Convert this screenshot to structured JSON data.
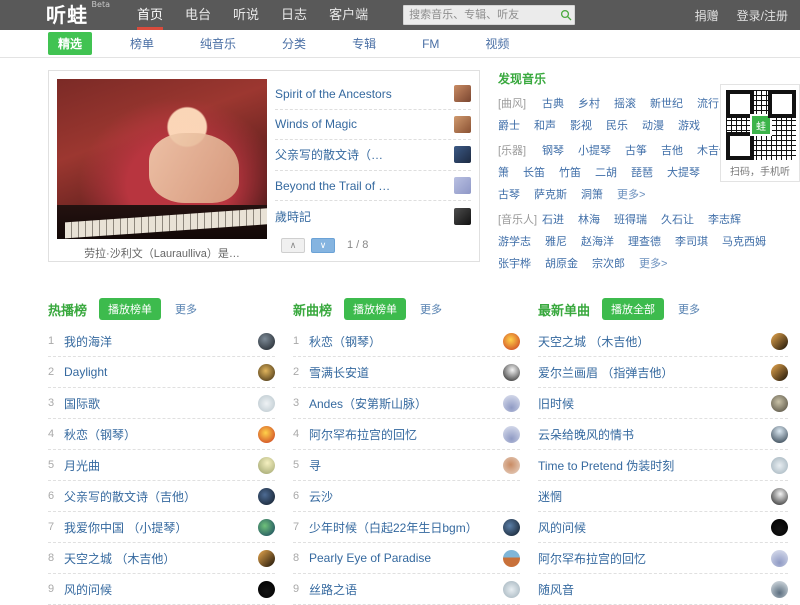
{
  "header": {
    "logo": "听蛙",
    "logo_badge": "Beta",
    "nav": [
      {
        "label": "首页",
        "active": true
      },
      {
        "label": "电台",
        "active": false
      },
      {
        "label": "听说",
        "active": false
      },
      {
        "label": "日志",
        "active": false
      },
      {
        "label": "客户端",
        "active": false
      }
    ],
    "search": {
      "placeholder": "搜索音乐、专辑、听友",
      "value": "",
      "icon": "search-icon"
    },
    "links": [
      {
        "label": "捐赠"
      },
      {
        "label": "登录/注册"
      }
    ],
    "accent_red": "#d94b3c",
    "bar_bg": "#595959"
  },
  "subnav": {
    "items": [
      {
        "label": "精选",
        "active": true
      },
      {
        "label": "榜单",
        "active": false
      },
      {
        "label": "纯音乐",
        "active": false
      },
      {
        "label": "分类",
        "active": false
      },
      {
        "label": "专辑",
        "active": false
      },
      {
        "label": "FM",
        "active": false
      },
      {
        "label": "视频",
        "active": false
      }
    ],
    "active_color": "#41c352"
  },
  "feature": {
    "caption": "劳拉·沙利文（Lauraulliva）是…",
    "list": [
      {
        "title": "Spirit of the Ancestors"
      },
      {
        "title": "Winds of Magic"
      },
      {
        "title": "父亲写的散文诗（吉他）"
      },
      {
        "title": "Beyond the Trail of Tears（…"
      },
      {
        "title": "歲時記"
      }
    ],
    "pager": {
      "up": "∧",
      "down": "∨",
      "counter": "1 / 8"
    }
  },
  "discover": {
    "title": "发现音乐",
    "groups": [
      {
        "label": "[曲风]",
        "rows": [
          [
            "古典",
            "乡村",
            "摇滚",
            "新世纪",
            "流行"
          ],
          [
            "爵士",
            "和声",
            "影视",
            "民乐",
            "动漫",
            "游戏"
          ]
        ]
      },
      {
        "label": "[乐器]",
        "rows": [
          [
            "钢琴",
            "小提琴",
            "古筝",
            "吉他",
            "木吉他"
          ],
          [
            "箫",
            "长笛",
            "竹笛",
            "二胡",
            "琵琶",
            "大提琴"
          ],
          [
            "古琴",
            "萨克斯",
            "洞箫",
            "更多>"
          ]
        ]
      },
      {
        "label": "[音乐人]",
        "rows": [
          [
            "石进",
            "林海",
            "班得瑞",
            "久石让",
            "李志辉"
          ],
          [
            "游学志",
            "雅尼",
            "赵海洋",
            "理查德",
            "李司琪",
            "马克西姆"
          ],
          [
            "张宇桦",
            "胡原金",
            "宗次郎",
            "更多>"
          ]
        ]
      }
    ]
  },
  "qr": {
    "caption": "扫码，手机听",
    "logo_char": "蛙",
    "logo_color": "#3cb44a"
  },
  "charts": [
    {
      "title": "热播榜",
      "button": "播放榜单",
      "more": "更多",
      "tracks": [
        {
          "rank": "1",
          "name": "我的海洋"
        },
        {
          "rank": "2",
          "name": "Daylight"
        },
        {
          "rank": "3",
          "name": "国际歌"
        },
        {
          "rank": "4",
          "name": "秋恋（钢琴）"
        },
        {
          "rank": "5",
          "name": "月光曲"
        },
        {
          "rank": "6",
          "name": "父亲写的散文诗（吉他）"
        },
        {
          "rank": "7",
          "name": "我爱你中国 （小提琴）"
        },
        {
          "rank": "8",
          "name": "天空之城 （木吉他）"
        },
        {
          "rank": "9",
          "name": "风的问候"
        }
      ]
    },
    {
      "title": "新曲榜",
      "button": "播放榜单",
      "more": "更多",
      "tracks": [
        {
          "rank": "1",
          "name": "秋恋（钢琴）"
        },
        {
          "rank": "2",
          "name": "雪满长安道"
        },
        {
          "rank": "3",
          "name": "Andes（安第斯山脉）"
        },
        {
          "rank": "4",
          "name": "阿尔罕布拉宫的回忆"
        },
        {
          "rank": "5",
          "name": "寻"
        },
        {
          "rank": "6",
          "name": "云沙"
        },
        {
          "rank": "7",
          "name": "少年时候（白起22年生日bgm）"
        },
        {
          "rank": "8",
          "name": "Pearly Eye of Paradise"
        },
        {
          "rank": "9",
          "name": "丝路之语"
        }
      ]
    },
    {
      "title": "最新单曲",
      "button": "播放全部",
      "more": "更多",
      "tracks": [
        {
          "rank": "",
          "name": "天空之城 （木吉他）"
        },
        {
          "rank": "",
          "name": "爱尔兰画眉 （指弹吉他）"
        },
        {
          "rank": "",
          "name": "旧时候"
        },
        {
          "rank": "",
          "name": "云朵给晚风的情书"
        },
        {
          "rank": "",
          "name": "Time to Pretend 伪装时刻"
        },
        {
          "rank": "",
          "name": "迷惘"
        },
        {
          "rank": "",
          "name": "风的问候"
        },
        {
          "rank": "",
          "name": "阿尔罕布拉宫的回忆"
        },
        {
          "rank": "",
          "name": "随风音"
        }
      ]
    }
  ]
}
